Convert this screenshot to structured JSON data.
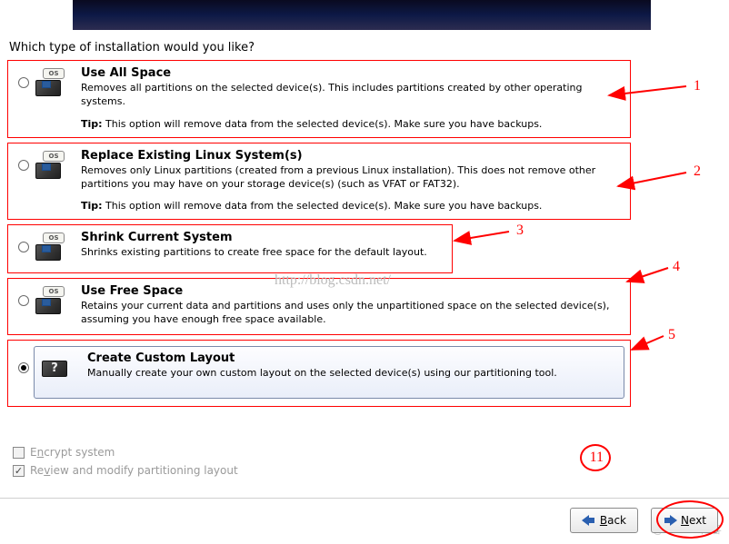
{
  "question": "Which type of installation would you like?",
  "options": {
    "use_all_space": {
      "title": "Use All Space",
      "desc": "Removes all partitions on the selected device(s).  This includes partitions created by other operating systems.",
      "tip_label": "Tip:",
      "tip": "This option will remove data from the selected device(s).  Make sure you have backups.",
      "selected": false,
      "icon": "disk-os"
    },
    "replace_linux": {
      "title": "Replace Existing Linux System(s)",
      "desc": "Removes only Linux partitions (created from a previous Linux installation).  This does not remove other partitions you may have on your storage device(s) (such as VFAT or FAT32).",
      "tip_label": "Tip:",
      "tip": "This option will remove data from the selected device(s).  Make sure you have backups.",
      "selected": false,
      "icon": "disk-os"
    },
    "shrink": {
      "title": "Shrink Current System",
      "desc": "Shrinks existing partitions to create free space for the default layout.",
      "selected": false,
      "icon": "disk-os"
    },
    "use_free_space": {
      "title": "Use Free Space",
      "desc": "Retains your current data and partitions and uses only the unpartitioned space on the selected device(s), assuming you have enough free space available.",
      "selected": false,
      "icon": "disk-os"
    },
    "custom": {
      "title": "Create Custom Layout",
      "desc": "Manually create your own custom layout on the selected device(s) using our partitioning tool.",
      "selected": true,
      "icon": "disk-question"
    }
  },
  "checkboxes": {
    "encrypt": {
      "label_pre": "E",
      "label_ul": "n",
      "label_post": "crypt system",
      "checked": false,
      "enabled": false
    },
    "review": {
      "label_pre": "Re",
      "label_ul": "v",
      "label_post": "iew and modify partitioning layout",
      "checked": true,
      "enabled": false
    }
  },
  "buttons": {
    "back_ul": "B",
    "back_rest": "ack",
    "next_ul": "N",
    "next_rest": "ext"
  },
  "annotations": {
    "n1": "1",
    "n2": "2",
    "n3": "3",
    "n4": "4",
    "n5": "5",
    "n11": "11"
  },
  "watermark": "http://blog.csdn.net/",
  "watermark2": "@51CTO博客"
}
